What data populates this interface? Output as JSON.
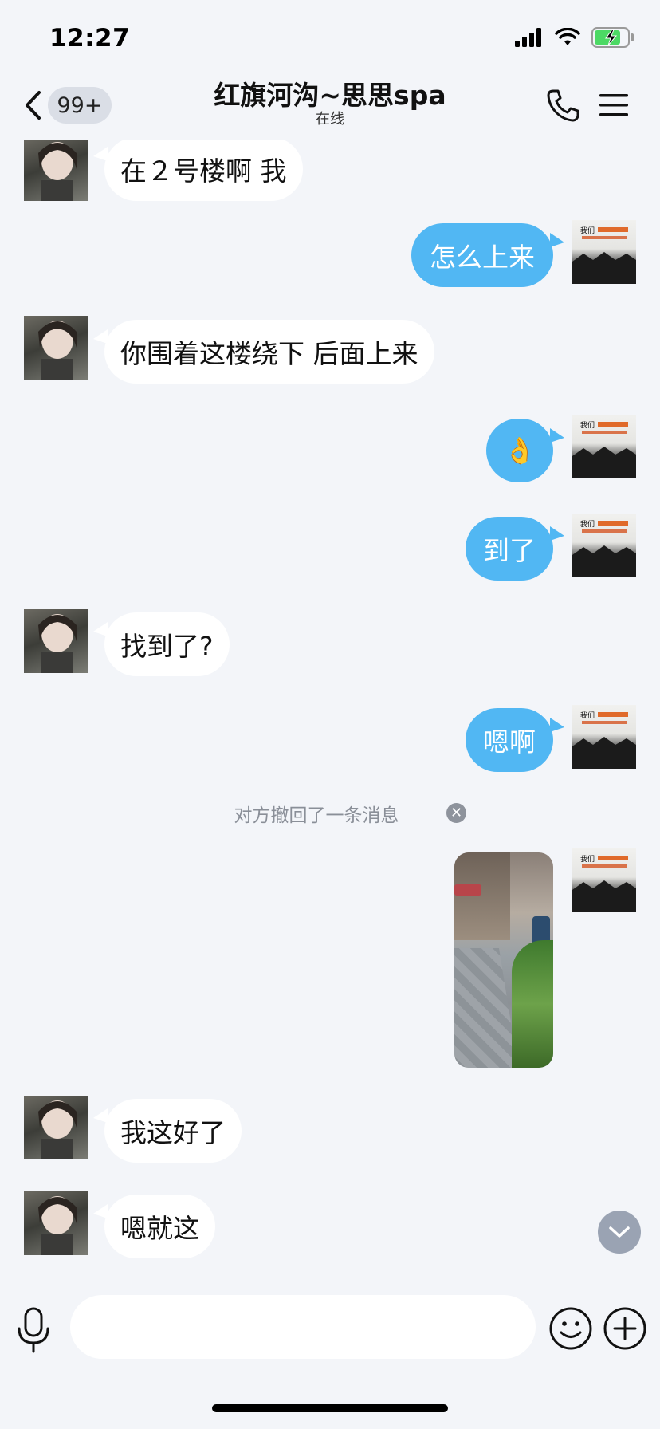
{
  "status_bar": {
    "time": "12:27",
    "battery_charging": true
  },
  "header": {
    "unread_badge": "99+",
    "title": "红旗河沟~思思spa",
    "subtitle": "在线"
  },
  "messages": [
    {
      "side": "in",
      "text": "在２号楼啊 我"
    },
    {
      "side": "out",
      "text": "怎么上来"
    },
    {
      "side": "in",
      "text": "你围着这楼绕下 后面上来"
    },
    {
      "side": "out",
      "text": "👌"
    },
    {
      "side": "out",
      "text": "到了"
    },
    {
      "side": "in",
      "text": "找到了?"
    },
    {
      "side": "out",
      "text": "嗯啊"
    },
    {
      "side": "system",
      "text": "对方撤回了一条消息"
    },
    {
      "side": "out",
      "type": "image"
    },
    {
      "side": "in",
      "text": "我这好了"
    },
    {
      "side": "in",
      "text": "嗯就这"
    }
  ],
  "input": {
    "placeholder": ""
  },
  "colors": {
    "background": "#f3f5f9",
    "outgoing_bubble": "#51b7f3",
    "incoming_bubble": "#ffffff",
    "badge_bg": "#dadee6",
    "scroll_button": "#9aa3b3"
  },
  "icons": {
    "back": "chevron-left-icon",
    "phone": "phone-icon",
    "menu": "hamburger-menu-icon",
    "recall_dismiss": "close-circle-icon",
    "scroll_down": "chevron-down-icon",
    "voice": "microphone-icon",
    "emoji": "smiley-icon",
    "more": "plus-circle-icon"
  }
}
